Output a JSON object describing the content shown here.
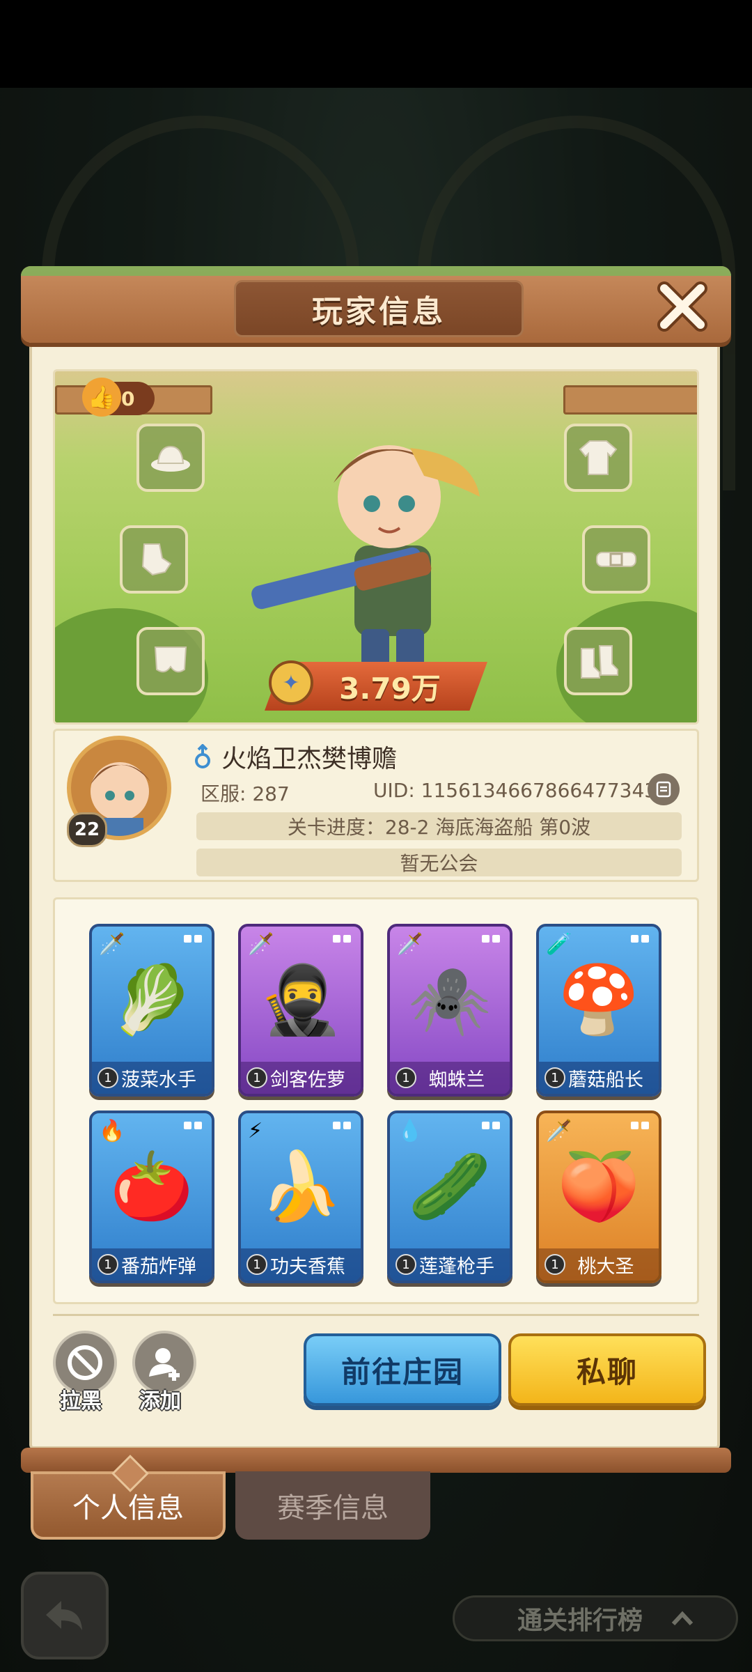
{
  "panel": {
    "title": "玩家信息"
  },
  "likes": {
    "count": "0"
  },
  "equipment": {
    "left": [
      "hat-icon",
      "gloves-icon",
      "pants-icon"
    ],
    "right": [
      "shirt-icon",
      "belt-icon",
      "boots-icon"
    ]
  },
  "power": {
    "value": "3.79万"
  },
  "player": {
    "name": "火焰卫杰樊博赡",
    "level": "22",
    "server_label": "区服: 287",
    "uid_label": "UID: 1156134667866477343",
    "progress": "关卡进度：28-2 海底海盗船 第0波",
    "guild": "暂无公会"
  },
  "heroes": [
    {
      "name": "菠菜水手",
      "level": "1",
      "color": "blue",
      "element": "sword",
      "icon": "🥬"
    },
    {
      "name": "剑客佐萝",
      "level": "1",
      "color": "purple",
      "element": "sword",
      "icon": "🥷"
    },
    {
      "name": "蜘蛛兰",
      "level": "1",
      "color": "purple",
      "element": "sword",
      "icon": "🕷️"
    },
    {
      "name": "蘑菇船长",
      "level": "1",
      "color": "blue",
      "element": "potion",
      "icon": "🍄"
    },
    {
      "name": "番茄炸弹",
      "level": "1",
      "color": "blue",
      "element": "fire",
      "icon": "🍅"
    },
    {
      "name": "功夫香蕉",
      "level": "1",
      "color": "blue",
      "element": "lightning",
      "icon": "🍌"
    },
    {
      "name": "莲蓬枪手",
      "level": "1",
      "color": "blue",
      "element": "water",
      "icon": "🥒"
    },
    {
      "name": "桃大圣",
      "level": "1",
      "color": "orange",
      "element": "sword",
      "icon": "🍑"
    }
  ],
  "actions": {
    "block_label": "拉黑",
    "add_label": "添加",
    "visit_label": "前往庄园",
    "chat_label": "私聊"
  },
  "tabs": {
    "personal": "个人信息",
    "season": "赛季信息"
  },
  "footer": {
    "rank_label": "通关排行榜"
  }
}
